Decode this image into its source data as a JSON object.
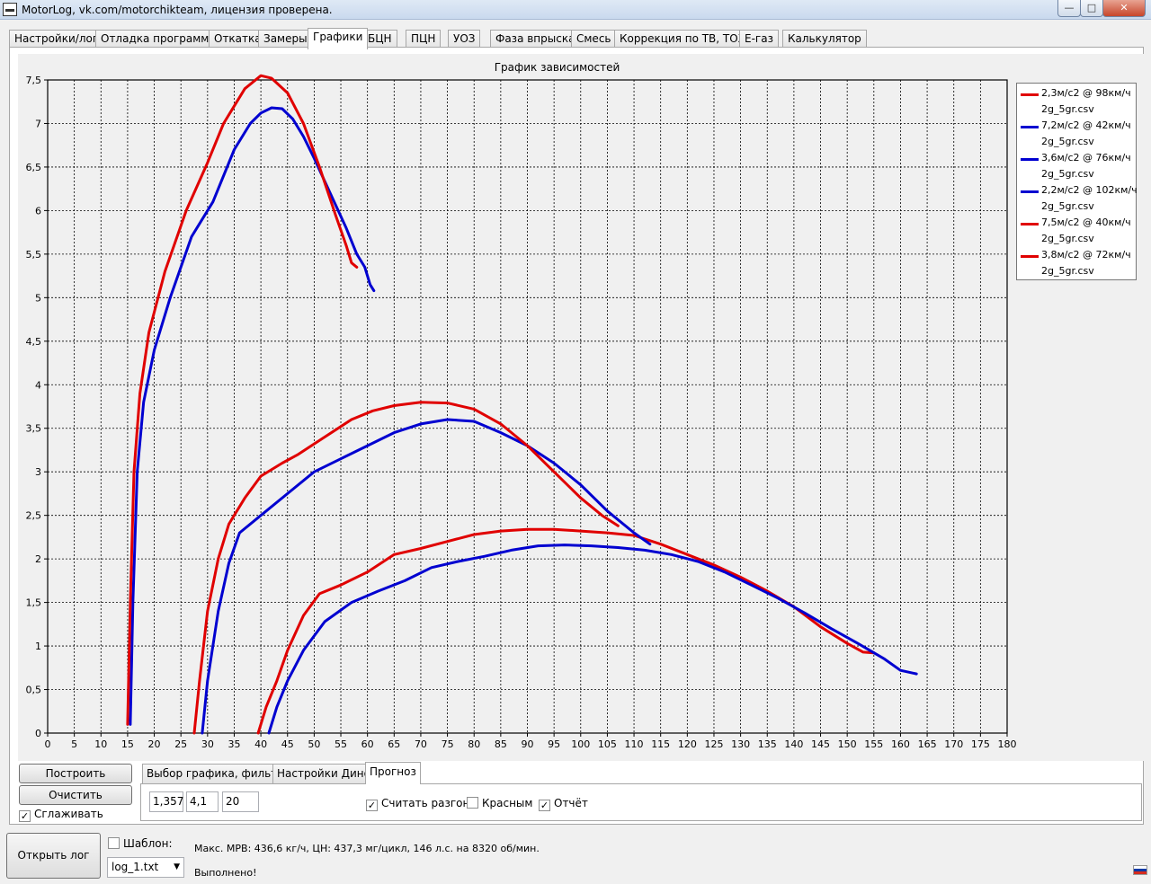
{
  "window": {
    "title": "MotorLog, vk.com/motorchikteam, лицензия проверена.",
    "minimize": "—",
    "maximize": "□",
    "close": "✕"
  },
  "tabs": [
    {
      "label": "Настройки/лог"
    },
    {
      "label": "Отладка программы"
    },
    {
      "label": "Откатка"
    },
    {
      "label": "Замеры"
    },
    {
      "label": "Графики",
      "active": true
    },
    {
      "label": "БЦН"
    },
    {
      "label": "ПЦН"
    },
    {
      "label": "УОЗ"
    },
    {
      "label": "Фаза впрыска"
    },
    {
      "label": "Смесь"
    },
    {
      "label": "Коррекция по ТВ, ТОЖ"
    },
    {
      "label": "E-газ"
    },
    {
      "label": "Калькулятор"
    }
  ],
  "chart_data": {
    "type": "line",
    "title": "График зависимостей",
    "xlim": [
      0,
      180
    ],
    "ylim": [
      0,
      7.5
    ],
    "xticks": [
      0,
      5,
      10,
      15,
      20,
      25,
      30,
      35,
      40,
      45,
      50,
      55,
      60,
      65,
      70,
      75,
      80,
      85,
      90,
      95,
      100,
      105,
      110,
      115,
      120,
      125,
      130,
      135,
      140,
      145,
      150,
      155,
      160,
      165,
      170,
      175,
      180
    ],
    "yticks": [
      0,
      0.5,
      1,
      1.5,
      2,
      2.5,
      3,
      3.5,
      4,
      4.5,
      5,
      5.5,
      6,
      6.5,
      7,
      7.5
    ],
    "xtick_labels": [
      "0",
      "5",
      "10",
      "15",
      "20",
      "25",
      "30",
      "35",
      "40",
      "45",
      "50",
      "55",
      "60",
      "65",
      "70",
      "75",
      "80",
      "85",
      "90",
      "95",
      "100",
      "105",
      "110",
      "115",
      "120",
      "125",
      "130",
      "135",
      "140",
      "145",
      "150",
      "155",
      "160",
      "165",
      "170",
      "175",
      "180"
    ],
    "ytick_labels": [
      "0",
      "0,5",
      "1",
      "1,5",
      "2",
      "2,5",
      "3",
      "3,5",
      "4",
      "4,5",
      "5",
      "5,5",
      "6",
      "6,5",
      "7",
      "7,5"
    ],
    "grid": true,
    "legend_position": "right",
    "series": [
      {
        "name": "2,3м/с2 @ 98км/ч",
        "file": "2g_5gr.csv",
        "color": "#e00000",
        "x": [
          39.5,
          41,
          43,
          45,
          48,
          51,
          55,
          60,
          65,
          70,
          75,
          80,
          85,
          90,
          95,
          100,
          105,
          110,
          115,
          120,
          125,
          130,
          135,
          140,
          145,
          150,
          153,
          155
        ],
        "y": [
          0,
          0.3,
          0.6,
          0.95,
          1.35,
          1.6,
          1.7,
          1.85,
          2.05,
          2.12,
          2.2,
          2.28,
          2.32,
          2.34,
          2.34,
          2.32,
          2.3,
          2.27,
          2.17,
          2.05,
          1.93,
          1.79,
          1.63,
          1.45,
          1.22,
          1.03,
          0.93,
          0.92
        ]
      },
      {
        "name": "7,2м/с2 @ 42км/ч",
        "file": "2g_5gr.csv",
        "color": "#0000d0",
        "x": [
          15.5,
          16,
          16.8,
          18,
          20,
          23,
          27,
          31,
          35,
          38,
          40,
          42,
          44,
          46,
          48,
          50,
          53,
          56,
          58,
          59.5,
          60.5,
          61.2
        ],
        "y": [
          0.1,
          1.5,
          3,
          3.8,
          4.4,
          5,
          5.7,
          6.1,
          6.7,
          7,
          7.12,
          7.18,
          7.17,
          7.05,
          6.85,
          6.6,
          6.2,
          5.8,
          5.5,
          5.35,
          5.15,
          5.08
        ]
      },
      {
        "name": "3,6м/с2 @ 76км/ч",
        "file": "2g_5gr.csv",
        "color": "#0000d0",
        "x": [
          29,
          30,
          32,
          34,
          36,
          40,
          45,
          50,
          55,
          60,
          65,
          70,
          75,
          80,
          85,
          90,
          95,
          100,
          105,
          110,
          113
        ],
        "y": [
          0,
          0.6,
          1.4,
          1.95,
          2.3,
          2.5,
          2.75,
          3,
          3.15,
          3.3,
          3.45,
          3.55,
          3.6,
          3.58,
          3.45,
          3.3,
          3.1,
          2.85,
          2.55,
          2.3,
          2.17
        ]
      },
      {
        "name": "2,2м/с2 @ 102км/ч",
        "file": "2g_5gr.csv",
        "color": "#0000d0",
        "x": [
          41.5,
          43,
          45,
          48,
          52,
          57,
          62,
          67,
          72,
          77,
          82,
          87,
          92,
          97,
          102,
          107,
          112,
          117,
          122,
          127,
          132,
          137,
          142,
          147,
          152,
          157,
          160,
          163
        ],
        "y": [
          0,
          0.3,
          0.6,
          0.95,
          1.28,
          1.5,
          1.63,
          1.75,
          1.9,
          1.97,
          2.03,
          2.1,
          2.15,
          2.16,
          2.15,
          2.13,
          2.1,
          2.05,
          1.97,
          1.85,
          1.7,
          1.55,
          1.38,
          1.2,
          1.03,
          0.85,
          0.72,
          0.68
        ]
      },
      {
        "name": "7,5м/с2 @ 40км/ч",
        "file": "2g_5gr.csv",
        "color": "#e00000",
        "x": [
          15,
          15.5,
          16.2,
          17.3,
          19,
          22,
          26,
          30,
          33,
          37,
          40,
          42,
          45,
          48,
          51,
          54,
          56,
          57,
          58
        ],
        "y": [
          0.1,
          1.5,
          3,
          3.9,
          4.6,
          5.3,
          6,
          6.55,
          7,
          7.4,
          7.55,
          7.52,
          7.35,
          7,
          6.5,
          5.95,
          5.6,
          5.4,
          5.35
        ]
      },
      {
        "name": "3,8м/с2 @ 72км/ч",
        "file": "2g_5gr.csv",
        "color": "#e00000",
        "x": [
          27.5,
          28.5,
          30,
          32,
          34,
          37,
          40,
          44,
          47,
          52,
          57,
          61,
          65,
          70,
          75,
          80,
          85,
          90,
          95,
          100,
          104,
          107
        ],
        "y": [
          0,
          0.6,
          1.4,
          2,
          2.4,
          2.7,
          2.95,
          3.1,
          3.2,
          3.4,
          3.6,
          3.7,
          3.76,
          3.8,
          3.79,
          3.72,
          3.55,
          3.3,
          3,
          2.7,
          2.5,
          2.38
        ]
      }
    ]
  },
  "controls": {
    "build_label": "Построить",
    "clear_label": "Очистить",
    "smooth_label": "Сглаживать",
    "smooth_checked": "✓"
  },
  "subtabs": [
    {
      "label": "Выбор графика, фильтр"
    },
    {
      "label": "Настройки Дино"
    },
    {
      "label": "Прогноз",
      "active": true
    }
  ],
  "forecast": {
    "field1": "1,357",
    "field2": "4,1",
    "field3": "20",
    "accel_label": "Считать разгон",
    "accel_checked": "✓",
    "red_label": "Красным",
    "report_label": "Отчёт",
    "report_checked": "✓"
  },
  "bottom": {
    "open_log_label": "Открыть лог",
    "template_label": "Шаблон:",
    "log_file": "log_1.txt",
    "dropdown_arrow": "▼",
    "status_line1": "Макс. МРВ: 436,6 кг/ч, ЦН: 437,3 мг/цикл, 146 л.с. на 8320 об/мин.",
    "status_line2": "Выполнено!",
    "flag_colors": [
      "#ffffff",
      "#0039a6",
      "#d52b1e"
    ]
  }
}
